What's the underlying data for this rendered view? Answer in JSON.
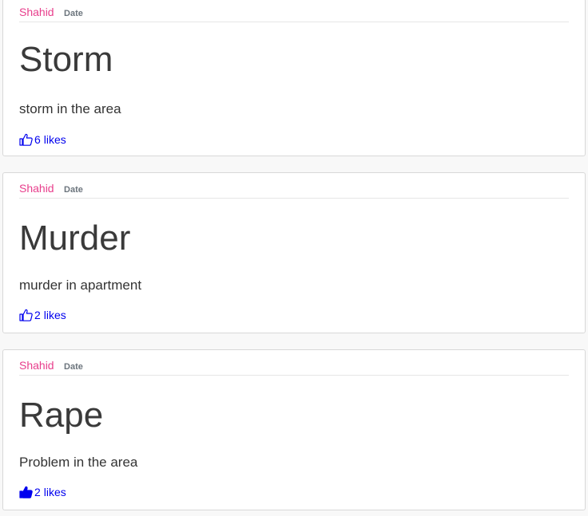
{
  "posts": [
    {
      "author": "Shahid",
      "date_label": "Date",
      "title": "Storm",
      "body": "storm in the area",
      "likes_count": "6",
      "likes_label": "likes",
      "liked": false,
      "like_icon": "thumbs-up-outline-icon"
    },
    {
      "author": "Shahid",
      "date_label": "Date",
      "title": "Murder",
      "body": "murder in apartment",
      "likes_count": "2",
      "likes_label": "likes",
      "liked": false,
      "like_icon": "thumbs-up-outline-icon"
    },
    {
      "author": "Shahid",
      "date_label": "Date",
      "title": "Rape",
      "body": "Problem in the area",
      "likes_count": "2",
      "likes_label": "likes",
      "liked": true,
      "like_icon": "thumbs-up-filled-icon"
    }
  ],
  "colors": {
    "author": "#e83e8c",
    "link": "#0000ee",
    "title": "#3a3a3a",
    "background": "#f8f8f8"
  }
}
